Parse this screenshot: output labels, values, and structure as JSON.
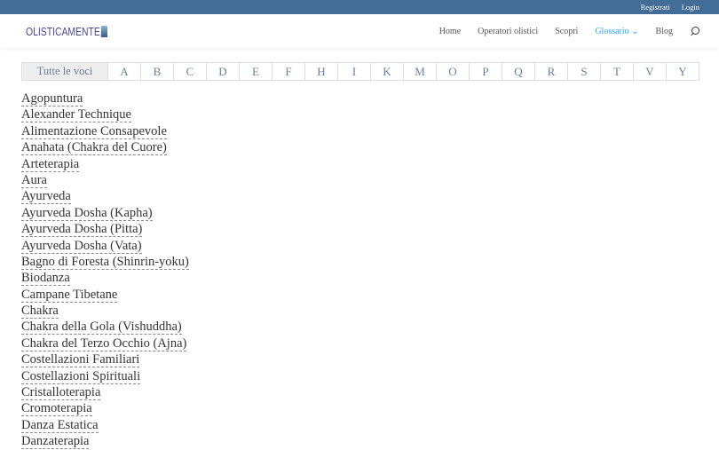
{
  "topbar": {
    "register": "Registrati",
    "login": "Login"
  },
  "logo": "OLISTICAMENTE",
  "nav": {
    "items": [
      "Home",
      "Operatori olistici",
      "Scopri",
      "Glossario",
      "Blog"
    ],
    "active": "Glossario",
    "accent": "#2ea3f2"
  },
  "filter": [
    "Tutte le voci",
    "A",
    "B",
    "C",
    "D",
    "E",
    "F",
    "H",
    "I",
    "K",
    "M",
    "O",
    "P",
    "Q",
    "R",
    "S",
    "T",
    "V",
    "Y"
  ],
  "terms": [
    "Agopuntura",
    "Alexander Technique",
    "Alimentazione Consapevole",
    "Anahata (Chakra del Cuore)",
    "Arteterapia",
    "Aura",
    "Ayurveda",
    "Ayurveda Dosha (Kapha)",
    "Ayurveda Dosha (Pitta)",
    "Ayurveda Dosha (Vata)",
    "Bagno di Foresta (Shinrin-yoku)",
    "Biodanza",
    "Campane Tibetane",
    "Chakra",
    "Chakra della Gola (Vishuddha)",
    "Chakra del Terzo Occhio (Ajna)",
    "Costellazioni Familiari",
    "Costellazioni Spirituali",
    "Cristalloterapia",
    "Cromoterapia",
    "Danza Estatica",
    "Danzaterapia"
  ]
}
